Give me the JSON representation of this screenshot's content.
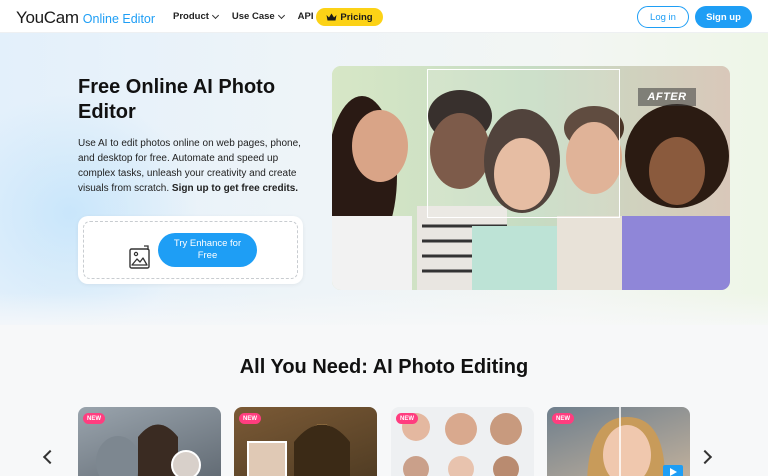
{
  "header": {
    "logo_main": "YouCam",
    "logo_sub": "Online Editor",
    "nav": [
      {
        "label": "Product",
        "has_dropdown": true
      },
      {
        "label": "Use Case",
        "has_dropdown": true
      },
      {
        "label": "API",
        "has_dropdown": false
      }
    ],
    "pricing_label": "Pricing",
    "login_label": "Log in",
    "signup_label": "Sign up"
  },
  "hero": {
    "title": "Free Online AI Photo Editor",
    "description": "Use AI to edit photos online on web pages, phone, and desktop for free. Automate and speed up complex tasks, unleash your creativity and create visuals from scratch. ",
    "description_bold": "Sign up to get free credits.",
    "upload_icon": "image-upload-icon",
    "cta_label": "Try Enhance for Free",
    "after_label": "AFTER"
  },
  "section": {
    "title": "All You Need: AI Photo Editing",
    "cards": [
      {
        "badge": "NEW"
      },
      {
        "badge": "NEW"
      },
      {
        "badge": "NEW"
      },
      {
        "badge": "NEW"
      }
    ]
  },
  "colors": {
    "accent": "#1e9ef5",
    "pricing": "#fcd216",
    "new_badge": "#ff3d7f"
  }
}
